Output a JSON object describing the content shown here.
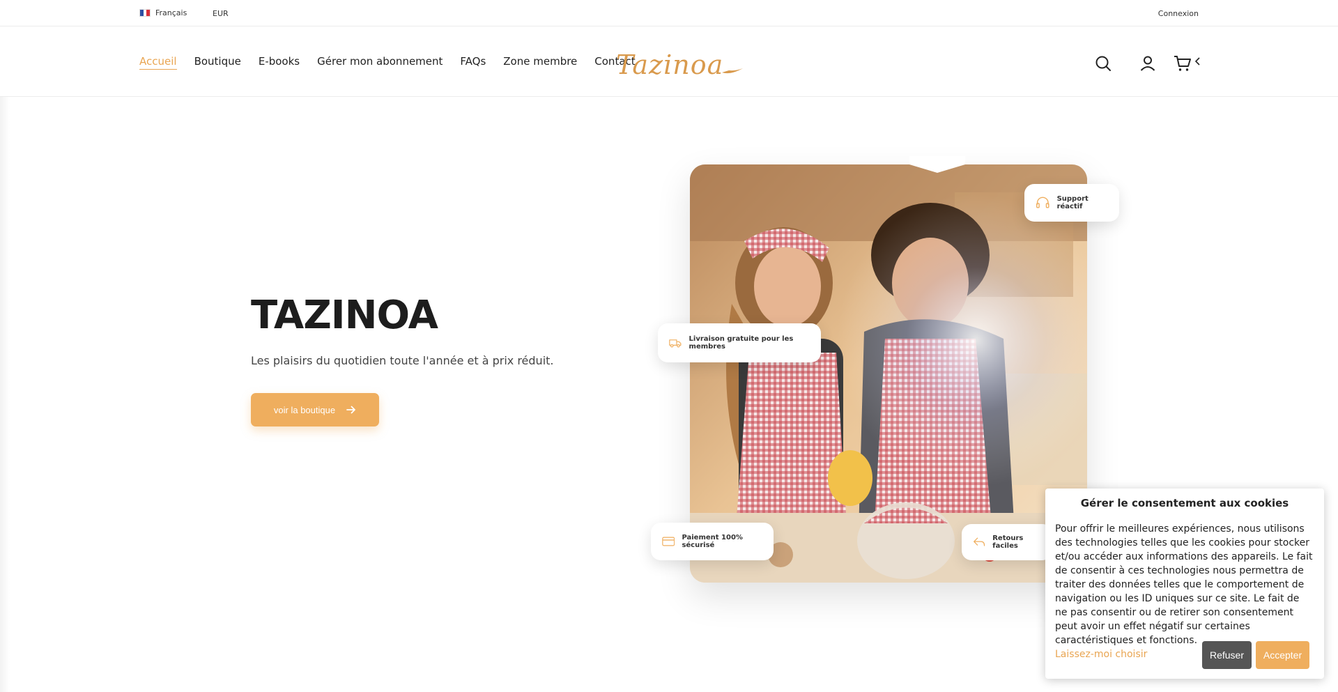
{
  "topbar": {
    "language": "Français",
    "currency": "EUR",
    "login": "Connexion"
  },
  "nav": [
    {
      "label": "Accueil",
      "active": true
    },
    {
      "label": "Boutique"
    },
    {
      "label": "E-books"
    },
    {
      "label": "Gérer mon abonnement"
    },
    {
      "label": "FAQs"
    },
    {
      "label": "Zone membre"
    },
    {
      "label": "Contact"
    }
  ],
  "logo": {
    "text": "Tazinoa"
  },
  "header_icons": [
    "search-icon",
    "user-icon",
    "cart-icon",
    "chevron-left-icon"
  ],
  "hero": {
    "title": "TAZINOA",
    "subtitle": "Les plaisirs du quotidien toute l'année et à prix réduit.",
    "cta": "voir la boutique"
  },
  "badges": {
    "support": "Support réactif",
    "delivery": "Livraison gratuite pour les membres",
    "payment": "Paiement 100% sécurisé",
    "returns": "Retours faciles"
  },
  "cookie": {
    "title": "Gérer le consentement aux cookies",
    "body": "Pour offrir le meilleures expériences, nous utilisons des technologies telles que les cookies pour stocker et/ou accéder aux informations des appareils. Le fait de consentir à ces technologies nous permettra de traiter des données telles que le comportement de navigation ou les ID uniques sur ce site. Le fait de ne pas consentir ou de retirer son consentement peut avoir un effet négatif sur certaines caractéristiques et fonctions.",
    "choose": "Laissez-moi choisir",
    "refuse": "Refuser",
    "accept": "Accepter"
  },
  "colors": {
    "accent": "#efae5e",
    "accent_text": "#e9a552",
    "dark_button": "#555555"
  }
}
